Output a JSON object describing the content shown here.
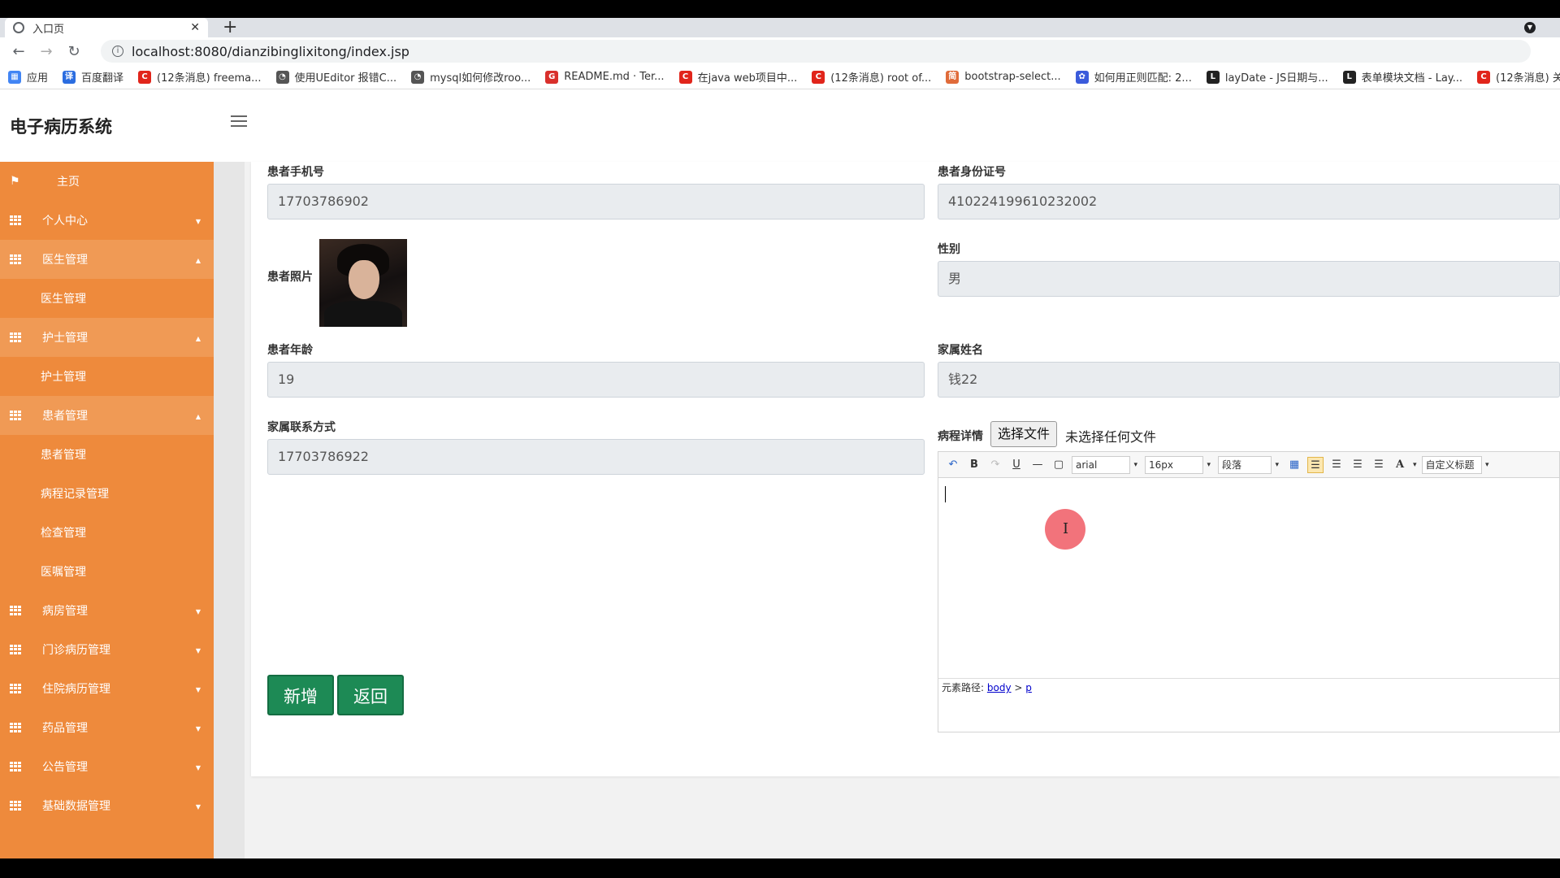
{
  "browser": {
    "tab_title": "入口页",
    "new_tab": "+",
    "url": "localhost:8080/dianzibinglixitong/index.jsp",
    "bookmarks": [
      {
        "label": "应用",
        "color": "#4285f4",
        "glyph": "▦"
      },
      {
        "label": "百度翻译",
        "color": "#2b6de0",
        "glyph": "译"
      },
      {
        "label": "(12条消息) freema...",
        "color": "#e1251b",
        "glyph": "C"
      },
      {
        "label": "使用UEditor 报错C...",
        "color": "#555555",
        "glyph": "◔"
      },
      {
        "label": "mysql如何修改roo...",
        "color": "#555555",
        "glyph": "◔"
      },
      {
        "label": "README.md · Ter...",
        "color": "#d9302c",
        "glyph": "G"
      },
      {
        "label": "在java web项目中...",
        "color": "#e1251b",
        "glyph": "C"
      },
      {
        "label": "(12条消息) root of...",
        "color": "#e1251b",
        "glyph": "C"
      },
      {
        "label": "bootstrap-select...",
        "color": "#e06b3a",
        "glyph": "简"
      },
      {
        "label": "如何用正则匹配: 2...",
        "color": "#3b5bdb",
        "glyph": "✿"
      },
      {
        "label": "layDate - JS日期与...",
        "color": "#222222",
        "glyph": "L"
      },
      {
        "label": "表单模块文档 - Lay...",
        "color": "#222222",
        "glyph": "L"
      },
      {
        "label": "(12条消息) 关于l",
        "color": "#e1251b",
        "glyph": "C"
      }
    ]
  },
  "app": {
    "brand": "电子病历系统"
  },
  "sidebar": {
    "items": [
      {
        "label": "主页",
        "type": "home"
      },
      {
        "label": "个人中心",
        "type": "menu",
        "caret": "▼"
      },
      {
        "label": "医生管理",
        "type": "menu",
        "caret": "▲",
        "active": true
      },
      {
        "label": "医生管理",
        "type": "sub"
      },
      {
        "label": "护士管理",
        "type": "menu",
        "caret": "▲",
        "active": true
      },
      {
        "label": "护士管理",
        "type": "sub"
      },
      {
        "label": "患者管理",
        "type": "menu",
        "caret": "▲",
        "active": true
      },
      {
        "label": "患者管理",
        "type": "sub"
      },
      {
        "label": "病程记录管理",
        "type": "sub"
      },
      {
        "label": "检查管理",
        "type": "sub"
      },
      {
        "label": "医嘱管理",
        "type": "sub"
      },
      {
        "label": "病房管理",
        "type": "menu",
        "caret": "▼"
      },
      {
        "label": "门诊病历管理",
        "type": "menu",
        "caret": "▼"
      },
      {
        "label": "住院病历管理",
        "type": "menu",
        "caret": "▼"
      },
      {
        "label": "药品管理",
        "type": "menu",
        "caret": "▼"
      },
      {
        "label": "公告管理",
        "type": "menu",
        "caret": "▼"
      },
      {
        "label": "基础数据管理",
        "type": "menu",
        "caret": "▼"
      }
    ]
  },
  "form": {
    "phone": {
      "label": "患者手机号",
      "value": "17703786902"
    },
    "idcard": {
      "label": "患者身份证号",
      "value": "410224199610232002"
    },
    "photo": {
      "label": "患者照片"
    },
    "gender": {
      "label": "性别",
      "value": "男"
    },
    "age": {
      "label": "患者年龄",
      "value": "19"
    },
    "family_name": {
      "label": "家属姓名",
      "value": "钱22"
    },
    "family_contact": {
      "label": "家属联系方式",
      "value": "17703786922"
    },
    "detail": {
      "label": "病程详情",
      "file_button": "选择文件",
      "file_status": "未选择任何文件"
    }
  },
  "editor": {
    "font_family": "arial",
    "font_size": "16px",
    "paragraph": "段落",
    "custom_title": "自定义标题",
    "font_color_glyph": "A",
    "path_label": "元素路径:",
    "path_body": "body",
    "path_sep": ">",
    "path_p": "p"
  },
  "actions": {
    "add": "新增",
    "back": "返回"
  }
}
